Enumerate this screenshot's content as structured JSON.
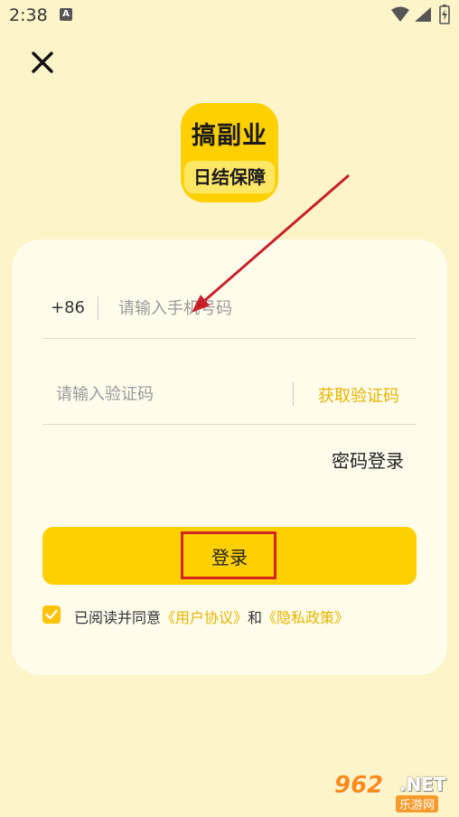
{
  "status_bar": {
    "time": "2:38",
    "notification_icon": "A"
  },
  "logo": {
    "line1": "搞副业",
    "line2": "日结保障"
  },
  "form": {
    "country_code": "+86",
    "phone_placeholder": "请输入手机号码",
    "code_placeholder": "请输入验证码",
    "get_code_label": "获取验证码",
    "password_login_label": "密码登录",
    "login_button_label": "登录"
  },
  "agreement": {
    "checked": true,
    "prefix": "已阅读并同意",
    "user_agreement": "《用户协议》",
    "and": "和",
    "privacy_policy": "《隐私政策》"
  },
  "watermark": {
    "number": "962",
    "suffix": ".NET",
    "subtitle": "乐游网"
  },
  "colors": {
    "background": "#FDF4C9",
    "card": "#FFFCEC",
    "accent": "#FFD000",
    "link": "#E6B400",
    "annotation": "#D42424"
  }
}
